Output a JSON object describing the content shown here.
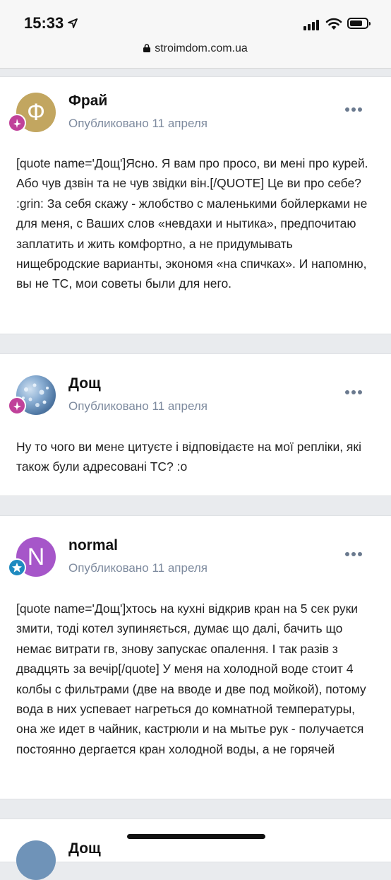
{
  "status_bar": {
    "time": "15:33"
  },
  "browser": {
    "url": "stroimdom.com.ua"
  },
  "posts": [
    {
      "author": "Фрай",
      "avatar_letter": "Ф",
      "avatar_color": "#c2a660",
      "published": "Опубликовано 11 апреля",
      "text": "[quote name='Дощ']Ясно. Я вам про просо, ви мені про курей. Або чув дзвін та не чув звідки він.[/QUOTE] Це ви про себе? :grin: За себя скажу - жлобство с маленькими бойлерками не для меня, с Ваших слов «невдахи и нытика», предпочитаю заплатить и жить комфортно, а не придумывать нищебродские варианты, экономя «на спичках». И напомню, вы не ТС, мои советы были для него."
    },
    {
      "author": "Дощ",
      "avatar_letter": "",
      "avatar_color": "#6f93b8",
      "published": "Опубликовано 11 апреля",
      "text": "Ну то чого ви мене цитуєте і відповідаєте на мої репліки, які також були адресовані ТС? :o"
    },
    {
      "author": "normal",
      "avatar_letter": "N",
      "avatar_color": "#a656c9",
      "published": "Опубликовано 11 апреля",
      "text": "[quote name='Дощ']хтось на кухні відкрив кран на 5 сек руки змити, тоді котел зупиняється, думає що далі, бачить що немає витрати гв, знову запускає опалення. І так разів з двадцять за вечір[/quote] У меня на холодной воде стоит 4 колбы с фильтрами (две на вводе и две под мойкой), потому вода в них успевает нагреться до комнатной температуры, она же идет в чайник, кастрюли и на мытье рук - получается постоянно дергается кран холодной воды, а не горячей"
    },
    {
      "author": "Дощ"
    }
  ]
}
